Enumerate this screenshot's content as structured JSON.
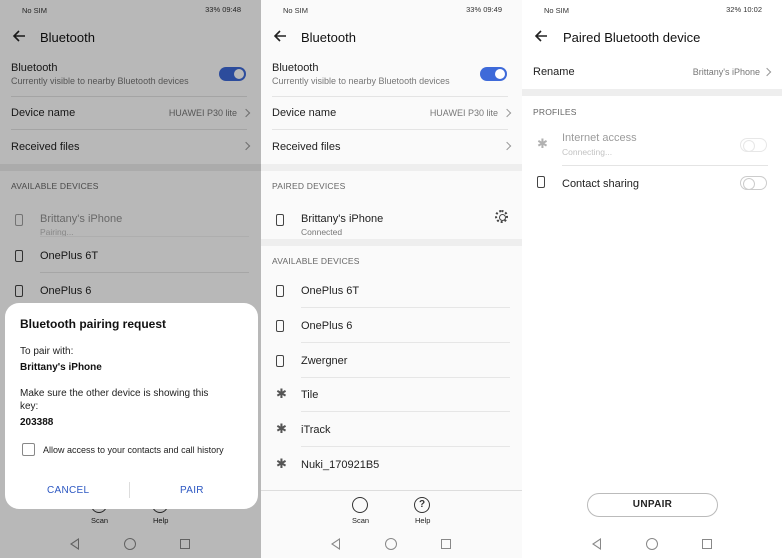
{
  "status": {
    "left": "No SIM",
    "right1": "33% 09:48",
    "right2": "33% 09:49",
    "right3": "32% 10:02"
  },
  "panel1": {
    "title": "Bluetooth",
    "bt_label": "Bluetooth",
    "bt_sub": "Currently visible to nearby Bluetooth devices",
    "device_name_label": "Device name",
    "device_name_value": "HUAWEI P30 lite",
    "received_files": "Received files",
    "available_header": "AVAILABLE DEVICES",
    "devices": [
      {
        "name": "Brittany's iPhone",
        "sub": "Pairing..."
      },
      {
        "name": "OnePlus 6T"
      },
      {
        "name": "OnePlus 6"
      }
    ],
    "dialog": {
      "title": "Bluetooth pairing request",
      "line1": "To pair with:",
      "device": "Brittany's iPhone",
      "line2a": "Make sure the other device is showing this",
      "line2b": "key:",
      "key": "203388",
      "checkbox_label": "Allow access to your contacts and call history",
      "cancel": "CANCEL",
      "pair": "PAIR"
    },
    "scan": "Scan",
    "help": "Help"
  },
  "panel2": {
    "title": "Bluetooth",
    "bt_label": "Bluetooth",
    "bt_sub": "Currently visible to nearby Bluetooth devices",
    "device_name_label": "Device name",
    "device_name_value": "HUAWEI P30 lite",
    "received_files": "Received files",
    "paired_header": "PAIRED DEVICES",
    "paired": {
      "name": "Brittany's iPhone",
      "sub": "Connected"
    },
    "available_header": "AVAILABLE DEVICES",
    "devices": [
      {
        "name": "OnePlus 6T"
      },
      {
        "name": "OnePlus 6"
      },
      {
        "name": "Zwergner"
      },
      {
        "name": "Tile"
      },
      {
        "name": "iTrack"
      },
      {
        "name": "Nuki_170921B5"
      }
    ],
    "scan": "Scan",
    "help": "Help"
  },
  "panel3": {
    "title": "Paired Bluetooth device",
    "rename_label": "Rename",
    "rename_value": "Brittany's iPhone",
    "profiles_header": "PROFILES",
    "internet_label": "Internet access",
    "internet_sub": "Connecting...",
    "contact_label": "Contact sharing",
    "unpair": "UNPAIR"
  }
}
